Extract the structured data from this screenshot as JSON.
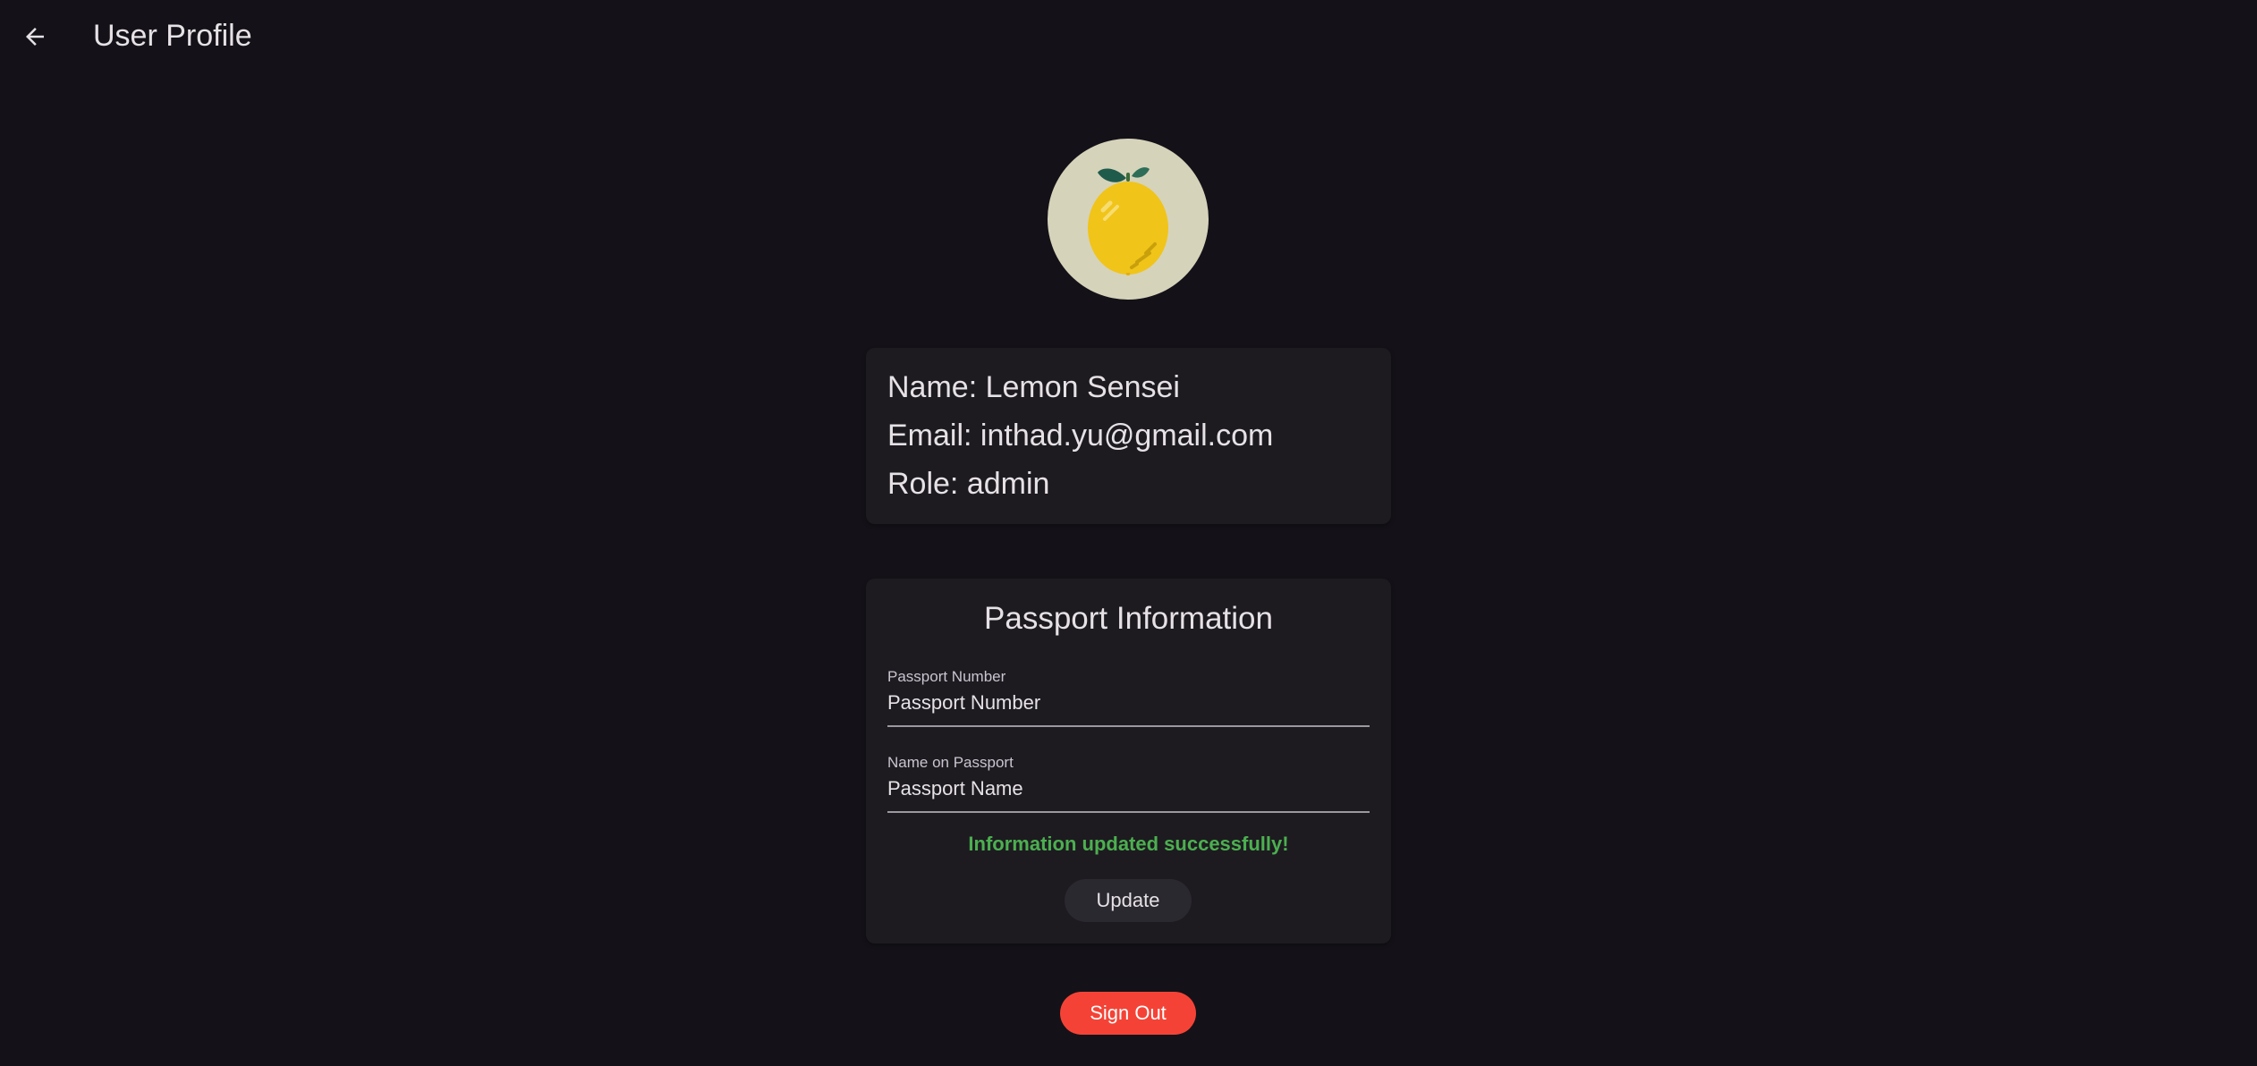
{
  "header": {
    "back_icon": "arrow-back-icon",
    "title": "User Profile"
  },
  "avatar": {
    "icon": "lemon-icon"
  },
  "profile": {
    "name_line": "Name: Lemon Sensei",
    "email_line": "Email: inthad.yu@gmail.com",
    "role_line": "Role: admin"
  },
  "passport": {
    "title": "Passport Information",
    "number_label": "Passport Number",
    "number_placeholder": "Passport Number",
    "name_label": "Name on Passport",
    "name_placeholder": "Passport Name",
    "status_message": "Information updated successfully!",
    "update_label": "Update"
  },
  "actions": {
    "sign_out_label": "Sign Out"
  },
  "colors": {
    "background": "#141218",
    "card": "#1d1b20",
    "success": "#4caf50",
    "danger": "#f44336"
  }
}
